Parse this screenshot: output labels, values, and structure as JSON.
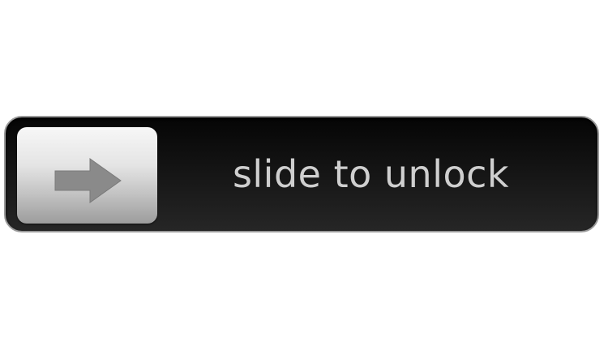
{
  "slider": {
    "label": "slide to unlock",
    "knob_icon": "arrow-right-icon",
    "progress": 0
  },
  "colors": {
    "track": "#141414",
    "track_border": "#9a9a9a",
    "knob_top": "#f7f7f7",
    "knob_bottom": "#9c9c9c",
    "arrow": "#8a8a8a",
    "label": "#cfcfcf"
  }
}
